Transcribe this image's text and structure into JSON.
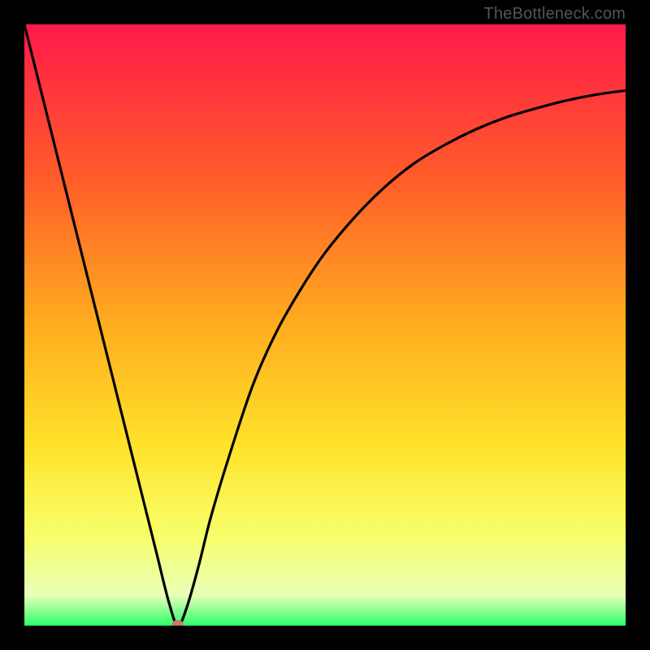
{
  "attribution": "TheBottleneck.com",
  "chart_data": {
    "type": "line",
    "title": "",
    "xlabel": "",
    "ylabel": "",
    "xlim": [
      0,
      100
    ],
    "ylim": [
      0,
      100
    ],
    "gradient_stops": [
      {
        "offset": 0,
        "color": "#ff1a4a"
      },
      {
        "offset": 25,
        "color": "#ff5a2a"
      },
      {
        "offset": 50,
        "color": "#ffad1f"
      },
      {
        "offset": 70,
        "color": "#ffe22a"
      },
      {
        "offset": 85,
        "color": "#f8ff6a"
      },
      {
        "offset": 95,
        "color": "#e8ffb8"
      },
      {
        "offset": 100,
        "color": "#2bff6a"
      }
    ],
    "series": [
      {
        "name": "bottleneck-curve",
        "x": [
          0,
          2,
          4,
          6,
          8,
          10,
          12,
          14,
          16,
          18,
          20,
          22,
          24,
          25.5,
          27,
          29,
          31,
          34,
          38,
          42,
          46,
          50,
          55,
          60,
          65,
          70,
          75,
          80,
          85,
          90,
          95,
          100
        ],
        "y": [
          100,
          92,
          84,
          76,
          68,
          60,
          52,
          44,
          36,
          28,
          20,
          12,
          4,
          0,
          3,
          10,
          18,
          28,
          40,
          49,
          56,
          62,
          68,
          73,
          77,
          80,
          82.5,
          84.5,
          86,
          87.3,
          88.3,
          89
        ]
      }
    ],
    "marker": {
      "x": 25.5,
      "y": 0,
      "color": "#c77a6a"
    }
  }
}
